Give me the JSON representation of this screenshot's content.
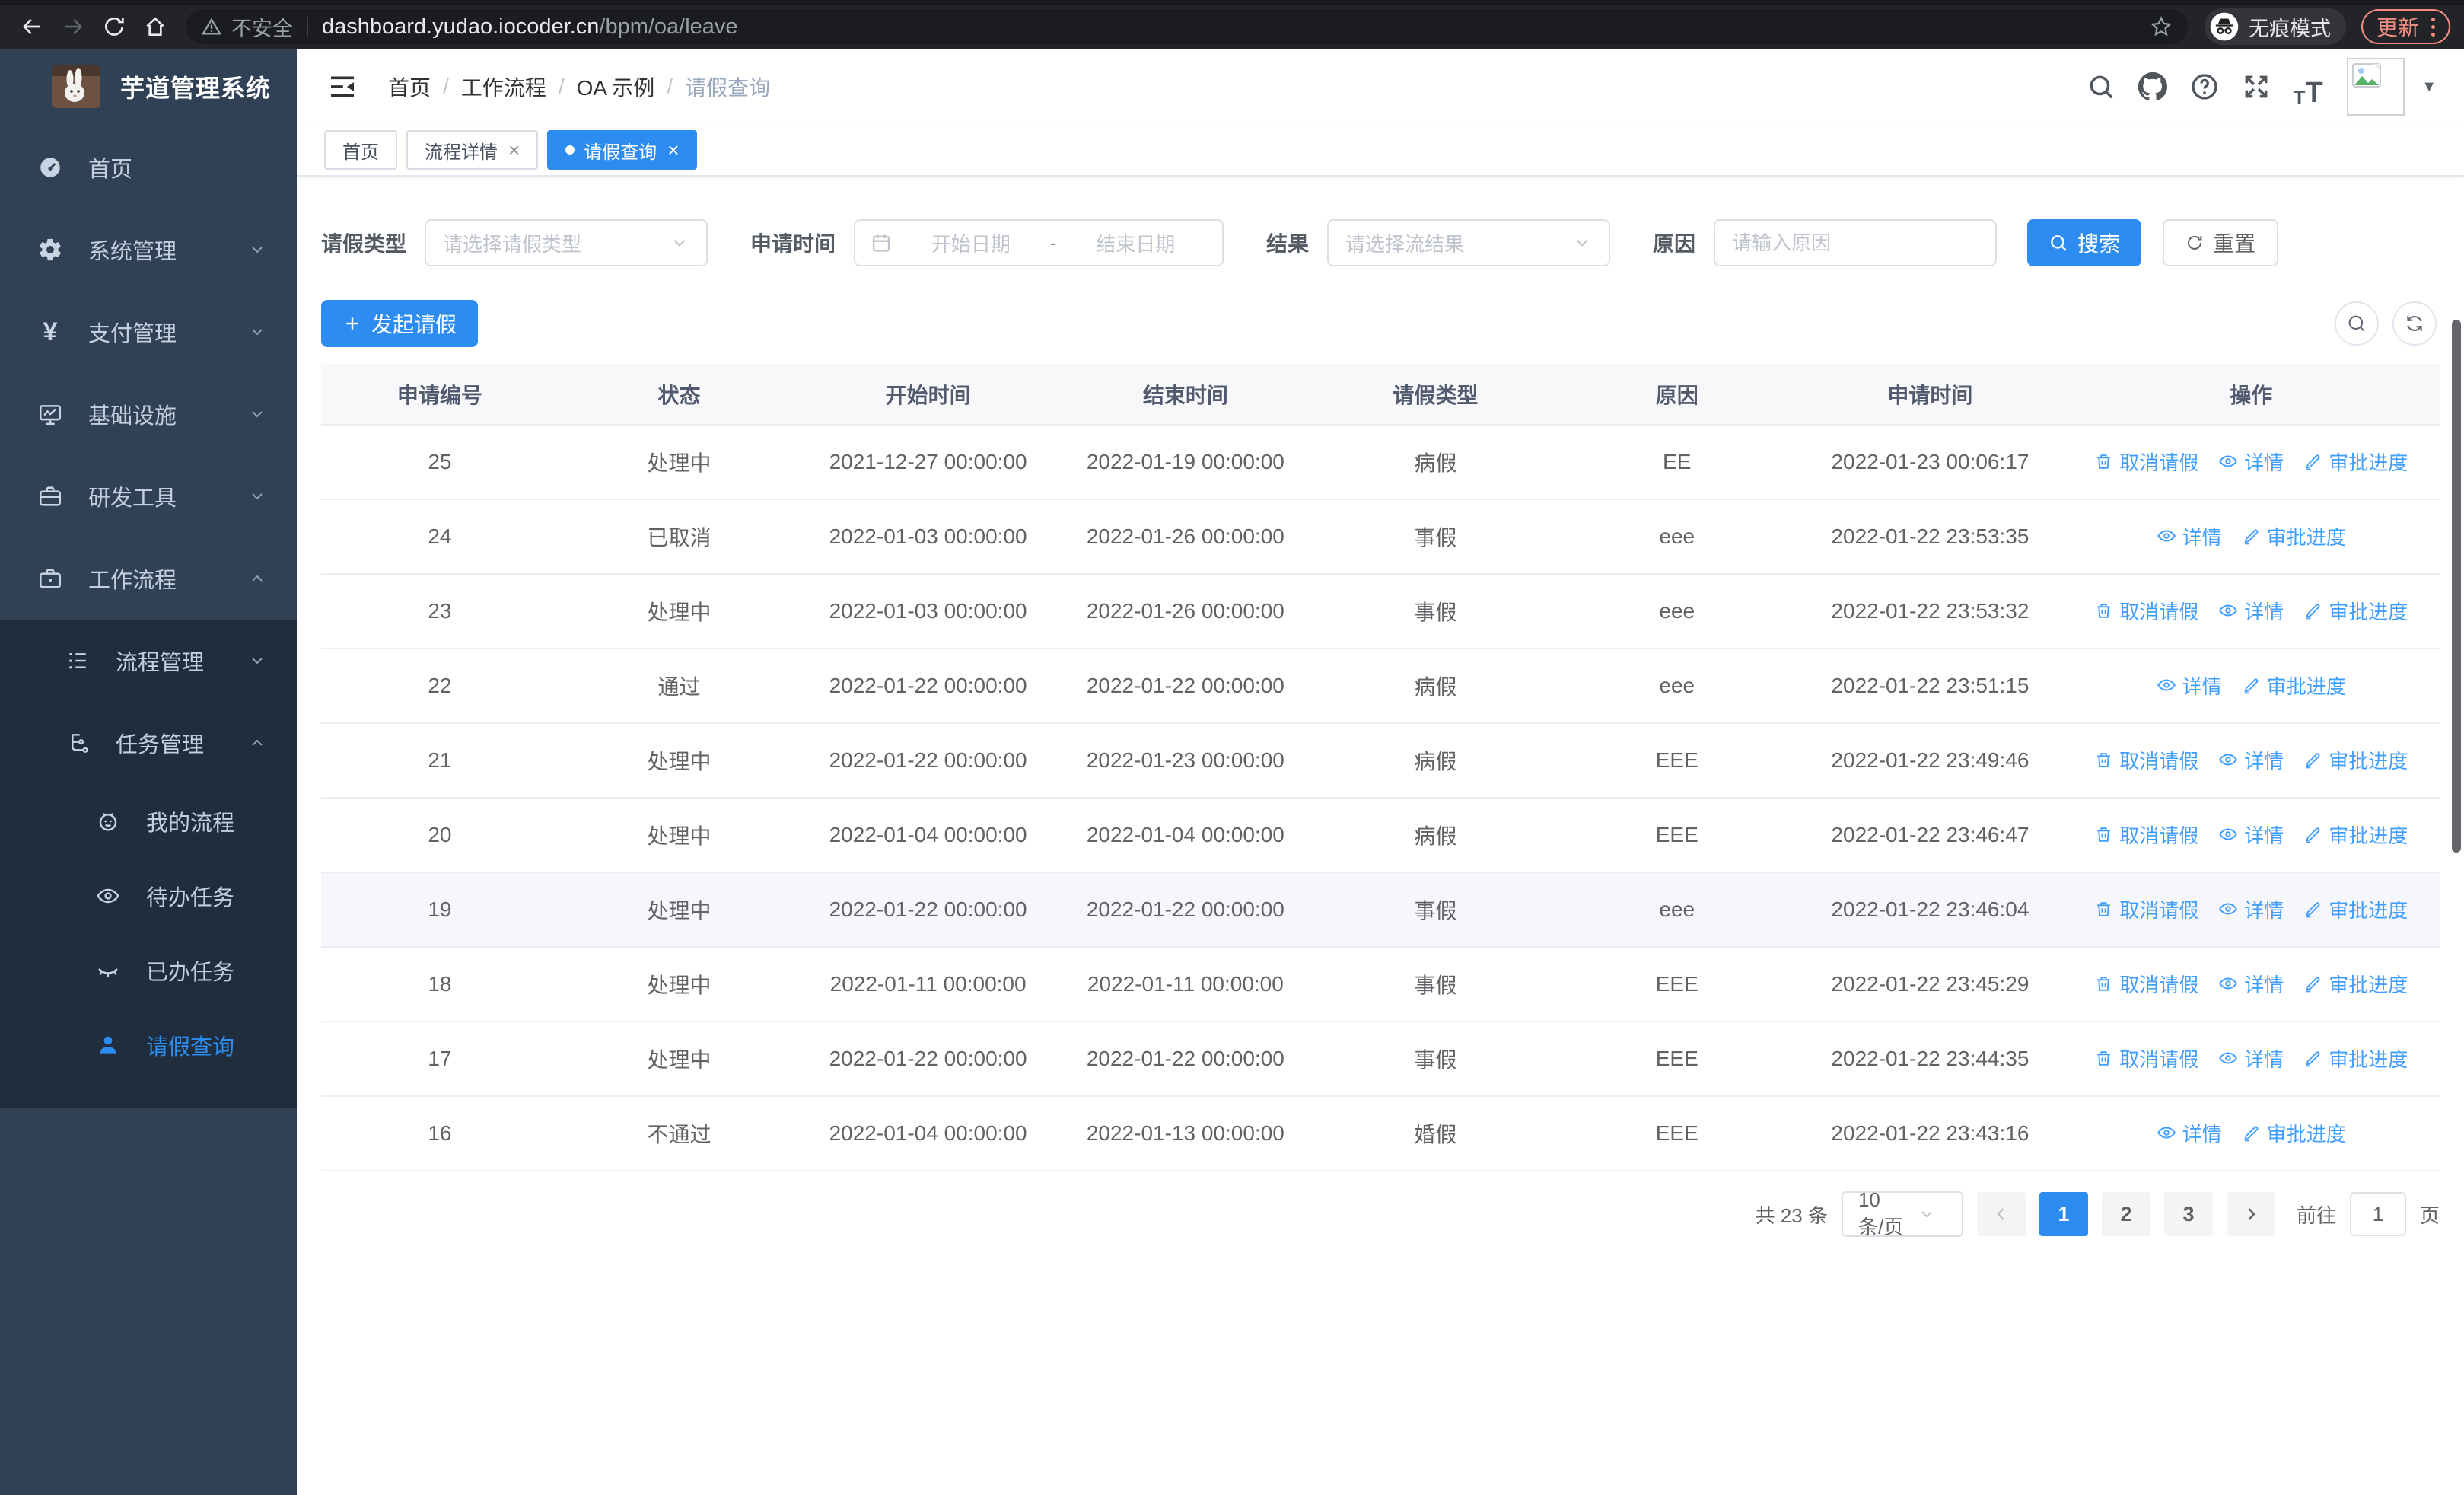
{
  "browser": {
    "security_label": "不安全",
    "url_host": "dashboard.yudao.iocoder.cn",
    "url_path": "/bpm/oa/leave",
    "incognito_label": "无痕模式",
    "update_label": "更新"
  },
  "sidebar": {
    "app_title": "芋道管理系统",
    "items": [
      {
        "label": "首页",
        "icon": "dashboard-icon",
        "level": 1
      },
      {
        "label": "系统管理",
        "icon": "gear-icon",
        "level": 1,
        "chevron": "down"
      },
      {
        "label": "支付管理",
        "icon": "yen-icon",
        "level": 1,
        "chevron": "down"
      },
      {
        "label": "基础设施",
        "icon": "monitor-icon",
        "level": 1,
        "chevron": "down"
      },
      {
        "label": "研发工具",
        "icon": "toolbox-icon",
        "level": 1,
        "chevron": "down"
      },
      {
        "label": "工作流程",
        "icon": "briefcase-icon",
        "level": 1,
        "chevron": "up"
      }
    ],
    "submenu": [
      {
        "label": "流程管理",
        "icon": "list-icon",
        "level": 2,
        "chevron": "down"
      },
      {
        "label": "任务管理",
        "icon": "flow-icon",
        "level": 2,
        "chevron": "up"
      },
      {
        "label": "我的流程",
        "icon": "robot-icon",
        "level": 3
      },
      {
        "label": "待办任务",
        "icon": "eye-open-icon",
        "level": 3
      },
      {
        "label": "已办任务",
        "icon": "eye-closed-icon",
        "level": 3
      },
      {
        "label": "请假查询",
        "icon": "user-icon",
        "level": 3,
        "active": true
      }
    ]
  },
  "header": {
    "breadcrumb": [
      "首页",
      "工作流程",
      "OA 示例",
      "请假查询"
    ]
  },
  "tabs": [
    {
      "label": "首页",
      "closable": false,
      "active": false
    },
    {
      "label": "流程详情",
      "closable": true,
      "active": false
    },
    {
      "label": "请假查询",
      "closable": true,
      "active": true
    }
  ],
  "filters": {
    "type_label": "请假类型",
    "type_placeholder": "请选择请假类型",
    "time_label": "申请时间",
    "time_start_placeholder": "开始日期",
    "time_separator": "-",
    "time_end_placeholder": "结束日期",
    "result_label": "结果",
    "result_placeholder": "请选择流结果",
    "reason_label": "原因",
    "reason_placeholder": "请输入原因",
    "search_label": "搜索",
    "reset_label": "重置"
  },
  "toolbar": {
    "create_label": "发起请假"
  },
  "table": {
    "columns": [
      "申请编号",
      "状态",
      "开始时间",
      "结束时间",
      "请假类型",
      "原因",
      "申请时间",
      "操作"
    ],
    "actions": {
      "cancel": "取消请假",
      "detail": "详情",
      "progress": "审批进度"
    },
    "rows": [
      {
        "id": "25",
        "status": "处理中",
        "start": "2021-12-27 00:00:00",
        "end": "2022-01-19 00:00:00",
        "type": "病假",
        "reason": "EE",
        "applied": "2022-01-23 00:06:17",
        "cancelable": true
      },
      {
        "id": "24",
        "status": "已取消",
        "start": "2022-01-03 00:00:00",
        "end": "2022-01-26 00:00:00",
        "type": "事假",
        "reason": "eee",
        "applied": "2022-01-22 23:53:35",
        "cancelable": false
      },
      {
        "id": "23",
        "status": "处理中",
        "start": "2022-01-03 00:00:00",
        "end": "2022-01-26 00:00:00",
        "type": "事假",
        "reason": "eee",
        "applied": "2022-01-22 23:53:32",
        "cancelable": true
      },
      {
        "id": "22",
        "status": "通过",
        "start": "2022-01-22 00:00:00",
        "end": "2022-01-22 00:00:00",
        "type": "病假",
        "reason": "eee",
        "applied": "2022-01-22 23:51:15",
        "cancelable": false
      },
      {
        "id": "21",
        "status": "处理中",
        "start": "2022-01-22 00:00:00",
        "end": "2022-01-23 00:00:00",
        "type": "病假",
        "reason": "EEE",
        "applied": "2022-01-22 23:49:46",
        "cancelable": true
      },
      {
        "id": "20",
        "status": "处理中",
        "start": "2022-01-04 00:00:00",
        "end": "2022-01-04 00:00:00",
        "type": "病假",
        "reason": "EEE",
        "applied": "2022-01-22 23:46:47",
        "cancelable": true
      },
      {
        "id": "19",
        "status": "处理中",
        "start": "2022-01-22 00:00:00",
        "end": "2022-01-22 00:00:00",
        "type": "事假",
        "reason": "eee",
        "applied": "2022-01-22 23:46:04",
        "cancelable": true,
        "hover": true
      },
      {
        "id": "18",
        "status": "处理中",
        "start": "2022-01-11 00:00:00",
        "end": "2022-01-11 00:00:00",
        "type": "事假",
        "reason": "EEE",
        "applied": "2022-01-22 23:45:29",
        "cancelable": true
      },
      {
        "id": "17",
        "status": "处理中",
        "start": "2022-01-22 00:00:00",
        "end": "2022-01-22 00:00:00",
        "type": "事假",
        "reason": "EEE",
        "applied": "2022-01-22 23:44:35",
        "cancelable": true
      },
      {
        "id": "16",
        "status": "不通过",
        "start": "2022-01-04 00:00:00",
        "end": "2022-01-13 00:00:00",
        "type": "婚假",
        "reason": "EEE",
        "applied": "2022-01-22 23:43:16",
        "cancelable": false
      }
    ]
  },
  "pagination": {
    "total_label": "共 23 条",
    "page_size": "10条/页",
    "pages": [
      "1",
      "2",
      "3"
    ],
    "active_page": "1",
    "goto_label": "前往",
    "goto_value": "1",
    "page_suffix": "页"
  },
  "colors": {
    "accent": "#2d8cf0",
    "link": "#409eff",
    "sidebar_bg": "#304156",
    "submenu_bg": "#1f2d3d",
    "update_pill": "#f28b82"
  }
}
